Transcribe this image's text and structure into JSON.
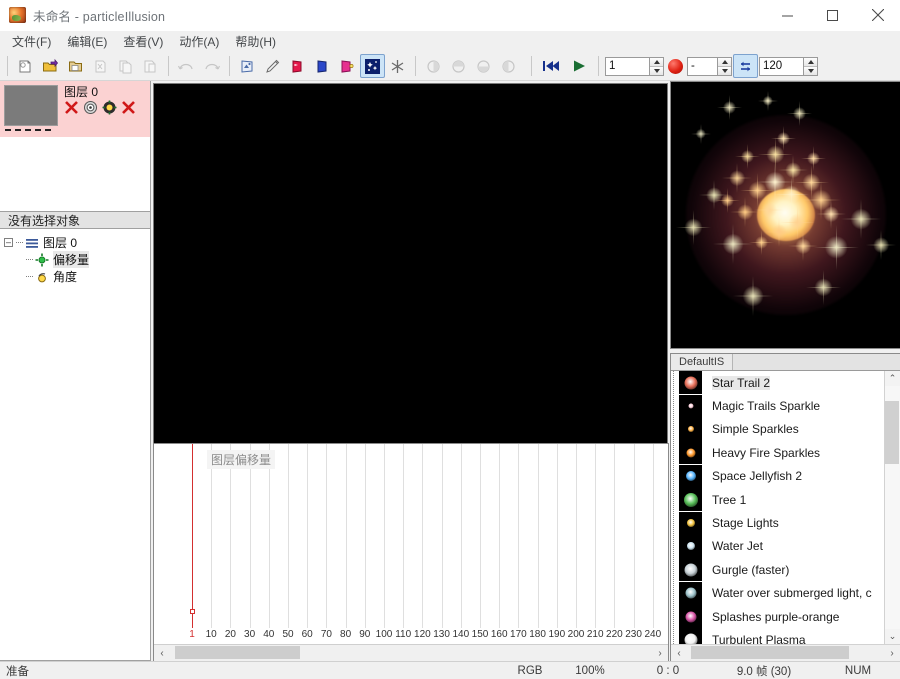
{
  "window": {
    "title": "未命名 - particleIllusion",
    "icon": "app-icon",
    "minimize": "–",
    "maximize": "☐",
    "close": "✕"
  },
  "menu": {
    "items": [
      {
        "label": "文件(F)"
      },
      {
        "label": "编辑(E)"
      },
      {
        "label": "查看(V)"
      },
      {
        "label": "动作(A)"
      },
      {
        "label": "帮助(H)"
      }
    ]
  },
  "toolbar": {
    "buttons": [
      {
        "name": "new-project-icon",
        "enabled": true
      },
      {
        "name": "open-project-icon",
        "enabled": true
      },
      {
        "name": "save-project-icon",
        "enabled": true
      },
      {
        "name": "cut-icon",
        "enabled": false
      },
      {
        "name": "copy-icon",
        "enabled": false
      },
      {
        "name": "paste-icon",
        "enabled": false
      },
      {
        "name": "undo-icon",
        "enabled": false
      },
      {
        "name": "redo-icon",
        "enabled": false
      },
      {
        "name": "background-image-icon",
        "enabled": true
      },
      {
        "name": "pen-tool-icon",
        "enabled": true
      },
      {
        "name": "red-layer-icon",
        "enabled": true
      },
      {
        "name": "blue-layer-icon",
        "enabled": true
      },
      {
        "name": "magenta-layer-icon",
        "enabled": true
      },
      {
        "name": "particle-emitter-icon",
        "enabled": true,
        "active": true
      },
      {
        "name": "deflector-icon",
        "enabled": true
      },
      {
        "name": "view-mode-1-icon",
        "enabled": false
      },
      {
        "name": "view-mode-2-icon",
        "enabled": false
      },
      {
        "name": "view-mode-3-icon",
        "enabled": false
      },
      {
        "name": "view-mode-4-icon",
        "enabled": false
      }
    ],
    "transport": {
      "rewind": "rewind-icon",
      "play": "play-icon",
      "record": "record-icon",
      "loop": "loop-icon"
    },
    "current_frame": "1",
    "frame_step": "-",
    "total_frames": "120"
  },
  "layers_panel": {
    "layer": {
      "name": "图层 0",
      "icons": [
        {
          "name": "delete-layer-icon"
        },
        {
          "name": "layer-properties-icon"
        },
        {
          "name": "layer-emitter-icon"
        },
        {
          "name": "layer-visibility-icon"
        }
      ]
    }
  },
  "tree_panel": {
    "header": "没有选择对象",
    "root": {
      "label": "图层 0",
      "icon": "layer-node-icon"
    },
    "children": [
      {
        "label": "偏移量",
        "icon": "offset-node-icon",
        "selected": true
      },
      {
        "label": "角度",
        "icon": "angle-node-icon",
        "selected": false
      }
    ]
  },
  "timeline": {
    "title": "图层偏移量",
    "playhead_frame": "1",
    "ticks": [
      "1",
      "10",
      "20",
      "30",
      "40",
      "50",
      "60",
      "70",
      "80",
      "90",
      "100",
      "110",
      "120",
      "130",
      "140",
      "150",
      "160",
      "170",
      "180",
      "190",
      "200",
      "210",
      "220",
      "230",
      "240"
    ],
    "scroll_left_arrow": "‹",
    "scroll_right_arrow": "›"
  },
  "library": {
    "tab": "DefaultIS",
    "scroll_up_arrow": "⌃",
    "scroll_down_arrow": "⌄",
    "scroll_left_arrow": "‹",
    "scroll_right_arrow": "›",
    "items": [
      {
        "label": "Star Trail 2",
        "selected": true,
        "color": "#e8705a",
        "size": 13
      },
      {
        "label": "Magic Trails Sparkle",
        "selected": false,
        "color": "#ffd2dd",
        "size": 5
      },
      {
        "label": "Simple Sparkles",
        "selected": false,
        "color": "#ffb347",
        "size": 6
      },
      {
        "label": "Heavy Fire Sparkles",
        "selected": false,
        "color": "#ff9a2e",
        "size": 9
      },
      {
        "label": "Space Jellyfish 2",
        "selected": false,
        "color": "#5ab7ff",
        "size": 10
      },
      {
        "label": "Tree 1",
        "selected": false,
        "color": "#59c05a",
        "size": 14
      },
      {
        "label": "Stage Lights",
        "selected": false,
        "color": "#f5c542",
        "size": 8
      },
      {
        "label": "Water Jet",
        "selected": false,
        "color": "#cfe6f2",
        "size": 8
      },
      {
        "label": "Gurgle (faster)",
        "selected": false,
        "color": "#c9d3d8",
        "size": 13
      },
      {
        "label": "Water over submerged light, c",
        "selected": false,
        "color": "#9fc4cc",
        "size": 11
      },
      {
        "label": "Splashes purple-orange",
        "selected": false,
        "color": "#d957a8",
        "size": 11
      },
      {
        "label": "Turbulent Plasma",
        "selected": false,
        "color": "#f2f2f2",
        "size": 13
      }
    ]
  },
  "statusbar": {
    "message": "准备",
    "color_mode": "RGB",
    "zoom": "100%",
    "coordinates": "0 : 0",
    "frame_time": "9.0 帧 (30)",
    "num_lock": "NUM"
  },
  "colors": {
    "accent": "#cce4f7",
    "layer_row": "#fbd2d2",
    "playhead": "#d32f2f",
    "record": "#e02113"
  }
}
